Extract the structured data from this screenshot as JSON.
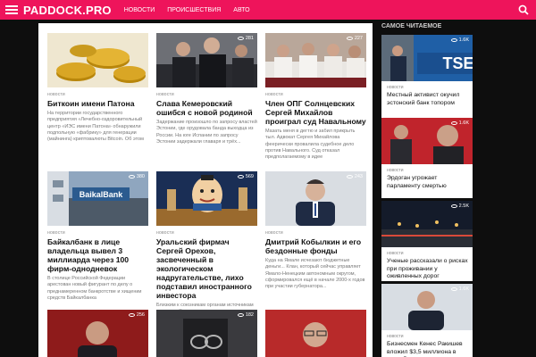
{
  "header": {
    "logo": "PADDOCK.PRO",
    "nav": [
      "НОВОСТИ",
      "ПРОИСШЕСТВИЯ",
      "АВТО"
    ],
    "bg_color": "#ee145b"
  },
  "articles": [
    {
      "category": "новости",
      "views": "",
      "title": "Биткоин имени Патона",
      "excerpt": "На территории государственного предприятия «Лечебно-оздоровительный центр «ИЭС имени Патона» обнаружили подпольную «фабрику» для генерации (майнинга) криптовалюты Bitcoin. Об этом гласит постановление"
    },
    {
      "category": "новости",
      "views": "281",
      "title": "Слава Кемеровский ошибся с новой родиной",
      "excerpt": "Задержание произошло по запросу властей Эстонии, где орудовала банда выходца из России. На юге Испании по запросу Эстонии задержали главаря и трёх..."
    },
    {
      "category": "новости",
      "views": "227",
      "title": "Член ОПГ Солнцевских Сергей Михайлов проиграл суд Навальному",
      "excerpt": "Мазать меня в дегтю и забил прикрыть тыл. Адвокат Сергея Михайлова феерически провалила судебное дело против Навального. Суд отказал предполагаемому в идее"
    },
    {
      "category": "новости",
      "views": "380",
      "title": "Байкалбанк в лице владельца вывел 3 миллиарда через 100 фирм-однодневок",
      "excerpt": "В столице Российской Федерации арестован новый фигурант по делу о преднамеренном банкротстве и хищении средств Байкалбанка"
    },
    {
      "category": "новости",
      "views": "569",
      "title": "Уральский фирмач Сергей Орехов, засвеченный в экологическом надругательстве, лихо подставил иностранного инвестора",
      "excerpt": "Близким к союзникам органам источникам портала «Компромат»"
    },
    {
      "category": "новости",
      "views": "243",
      "title": "Дмитрий Кобылкин и его бездонные фонды",
      "excerpt": "Куда на Ямале исчезают бюджетные деньги... Клан, который сейчас управляет Ямало-Ненецким автономным округом, сформировался ещё в начале 2000-х годов при участии губернатора..."
    },
    {
      "category": "новости",
      "views": "256",
      "title": "",
      "excerpt": ""
    },
    {
      "category": "новости",
      "views": "182",
      "title": "",
      "excerpt": ""
    },
    {
      "category": "новости",
      "views": "",
      "title": "",
      "excerpt": ""
    }
  ],
  "sidebar": {
    "title": "САМОЕ ЧИТАЕМОЕ",
    "items": [
      {
        "category": "новости",
        "views": "1.6K",
        "title": "Местный активист окучил эстонский банк топором"
      },
      {
        "category": "новости",
        "views": "1.6K",
        "title": "Эрдоган угрожает парламенту смертью"
      },
      {
        "category": "новости",
        "views": "2.5K",
        "title": "Ученые рассказали о рисках при проживании у оживленных дорог"
      },
      {
        "category": "новости",
        "views": "1.6K",
        "title": "Бизнесмен Кенес Ракишев вложил $3,5 миллиона в разработку умных"
      }
    ]
  }
}
